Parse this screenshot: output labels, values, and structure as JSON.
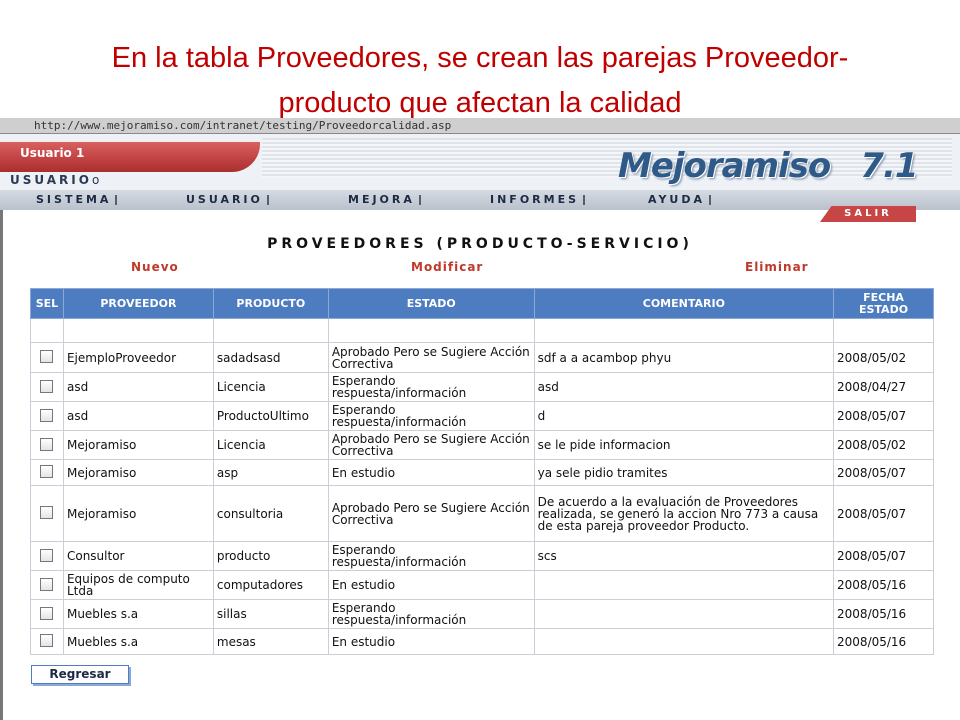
{
  "slide": {
    "title_line1": "En la tabla Proveedores, se crean las parejas Proveedor-",
    "title_line2": "producto que afectan la calidad"
  },
  "browser": {
    "url": "http://www.mejoramiso.com/intranet/testing/Proveedorcalidad.asp"
  },
  "header": {
    "user_tab": "Usuario 1",
    "user_label": "USUARIO",
    "user_label_suffix": "o",
    "logo_name": "Mejoramiso",
    "logo_version": "7.1"
  },
  "nav": {
    "items": [
      "SISTEMA",
      "USUARIO",
      "MEJORA",
      "INFORMES",
      "AYUDA"
    ],
    "salir": "SALIR"
  },
  "page": {
    "heading": "PROVEEDORES (PRODUCTO-SERVICIO)",
    "actions": {
      "nuevo": "Nuevo",
      "modificar": "Modificar",
      "eliminar": "Eliminar"
    }
  },
  "table": {
    "headers": [
      "SEL",
      "PROVEEDOR",
      "PRODUCTO",
      "ESTADO",
      "COMENTARIO",
      "FECHA ESTADO"
    ],
    "headers_fecha": [
      "FECHA",
      "ESTADO"
    ],
    "rows": [
      {
        "proveedor": "EjemploProveedor",
        "producto": "sadadsasd",
        "estado": "Aprobado Pero se Sugiere Acción Correctiva",
        "comentario": "sdf a a acambop phyu",
        "fecha": "2008/05/02"
      },
      {
        "proveedor": "asd",
        "producto": "Licencia",
        "estado": "Esperando respuesta/información",
        "comentario": "asd",
        "fecha": "2008/04/27"
      },
      {
        "proveedor": "asd",
        "producto": "ProductoUltimo",
        "estado": "Esperando respuesta/información",
        "comentario": "d",
        "fecha": "2008/05/07"
      },
      {
        "proveedor": "Mejoramiso",
        "producto": "Licencia",
        "estado": "Aprobado Pero se Sugiere Acción Correctiva",
        "comentario": "se le pide informacion",
        "fecha": "2008/05/02"
      },
      {
        "proveedor": "Mejoramiso",
        "producto": "asp",
        "estado": "En estudio",
        "comentario": "ya sele pidio tramites",
        "fecha": "2008/05/07"
      },
      {
        "proveedor": "Mejoramiso",
        "producto": "consultoria",
        "estado": "Aprobado Pero se Sugiere Acción Correctiva",
        "comentario": "De acuerdo a la evaluación de Proveedores realizada, se generó la accion Nro 773 a causa de esta pareja proveedor Producto.",
        "fecha": "2008/05/07"
      },
      {
        "proveedor": "Consultor",
        "producto": "producto",
        "estado": "Esperando respuesta/información",
        "comentario": "scs",
        "fecha": "2008/05/07"
      },
      {
        "proveedor": "Equipos de computo Ltda",
        "producto": "computadores",
        "estado": "En estudio",
        "comentario": "",
        "fecha": "2008/05/16"
      },
      {
        "proveedor": "Muebles s.a",
        "producto": "sillas",
        "estado": "Esperando respuesta/información",
        "comentario": "",
        "fecha": "2008/05/16"
      },
      {
        "proveedor": "Muebles s.a",
        "producto": "mesas",
        "estado": "En estudio",
        "comentario": "",
        "fecha": "2008/05/16"
      }
    ]
  },
  "footer": {
    "back_button": "Regresar"
  }
}
